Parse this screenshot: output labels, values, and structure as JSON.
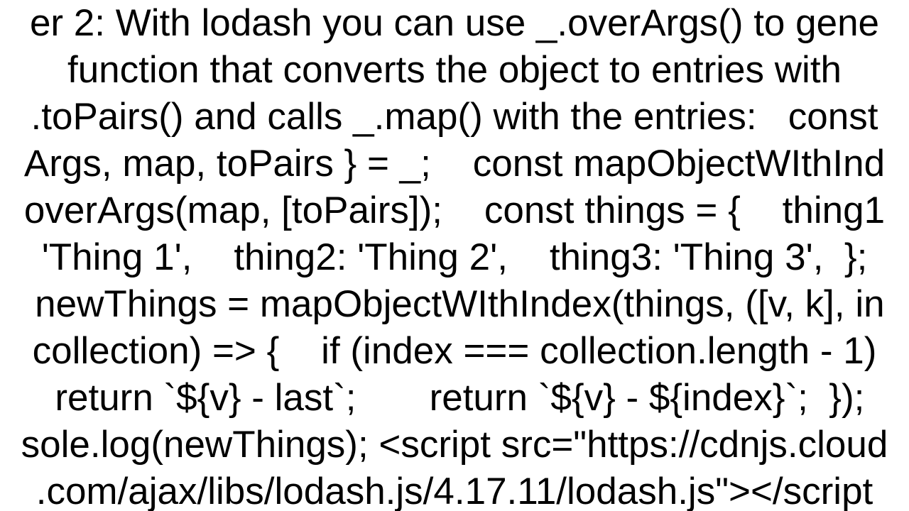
{
  "body": {
    "lines": [
      "er 2: With lodash you can use _.overArgs() to gene",
      "function that converts the object to entries with",
      ".toPairs() and calls _.map() with the entries:   const",
      "Args, map, toPairs } = _;    const mapObjectWIthInd",
      "overArgs(map, [toPairs]);    const things = {    thing1",
      "'Thing 1',    thing2: 'Thing 2',    thing3: 'Thing 3',  };",
      " newThings = mapObjectWIthIndex(things, ([v, k], in",
      "collection) => {    if (index === collection.length - 1)",
      " return `${v} - last`;       return `${v} - ${index}`;  });",
      "sole.log(newThings); <script src=\"https://cdnjs.cloud",
      ".com/ajax/libs/lodash.js/4.17.11/lodash.js\"></script"
    ]
  }
}
